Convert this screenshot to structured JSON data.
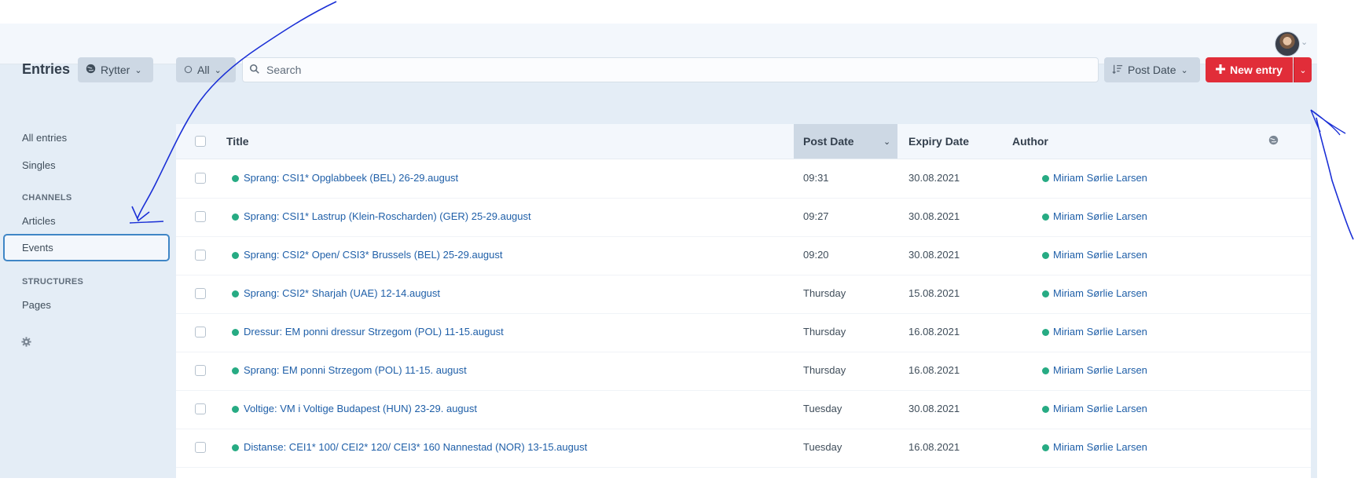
{
  "header": {
    "user_caret": "⌄"
  },
  "toolbar": {
    "page_title": "Entries",
    "site_label": "Rytter",
    "status_label": "All",
    "search_placeholder": "Search",
    "sort_label": "Post Date",
    "new_entry_label": "New entry"
  },
  "sidebar": {
    "all_entries": "All entries",
    "singles": "Singles",
    "channels_heading": "CHANNELS",
    "articles": "Articles",
    "events": "Events",
    "structures_heading": "STRUCTURES",
    "pages": "Pages"
  },
  "table": {
    "columns": {
      "title": "Title",
      "post_date": "Post Date",
      "expiry_date": "Expiry Date",
      "author": "Author"
    },
    "rows": [
      {
        "title": "Sprang: CSI1* Opglabbeek (BEL) 26-29.august",
        "post_date": "09:31",
        "expiry_date": "30.08.2021",
        "author": "Miriam Sørlie Larsen"
      },
      {
        "title": "Sprang: CSI1* Lastrup (Klein-Roscharden) (GER) 25-29.august",
        "post_date": "09:27",
        "expiry_date": "30.08.2021",
        "author": "Miriam Sørlie Larsen"
      },
      {
        "title": "Sprang: CSI2* Open/ CSI3* Brussels (BEL) 25-29.august",
        "post_date": "09:20",
        "expiry_date": "30.08.2021",
        "author": "Miriam Sørlie Larsen"
      },
      {
        "title": "Sprang: CSI2* Sharjah (UAE) 12-14.august",
        "post_date": "Thursday",
        "expiry_date": "15.08.2021",
        "author": "Miriam Sørlie Larsen"
      },
      {
        "title": "Dressur: EM ponni dressur Strzegom (POL) 11-15.august",
        "post_date": "Thursday",
        "expiry_date": "16.08.2021",
        "author": "Miriam Sørlie Larsen"
      },
      {
        "title": "Sprang: EM ponni Strzegom (POL) 11-15. august",
        "post_date": "Thursday",
        "expiry_date": "16.08.2021",
        "author": "Miriam Sørlie Larsen"
      },
      {
        "title": "Voltige: VM i Voltige Budapest (HUN) 23-29. august",
        "post_date": "Tuesday",
        "expiry_date": "30.08.2021",
        "author": "Miriam Sørlie Larsen"
      },
      {
        "title": "Distanse: CEI1* 100/ CEI2* 120/ CEI3* 160 Nannestad (NOR) 13-15.august",
        "post_date": "Tuesday",
        "expiry_date": "16.08.2021",
        "author": "Miriam Sørlie Larsen"
      }
    ]
  },
  "colors": {
    "accent_red": "#e12d39",
    "link_blue": "#1f5fa8",
    "status_green": "#27ab83",
    "selected_border": "#3f86c6",
    "annotation_ink": "#1a2fd6"
  },
  "icons": [
    "globe-icon",
    "circle-icon",
    "chevron-down-icon",
    "search-icon",
    "sort-icon",
    "plus-icon",
    "gear-icon",
    "avatar"
  ]
}
